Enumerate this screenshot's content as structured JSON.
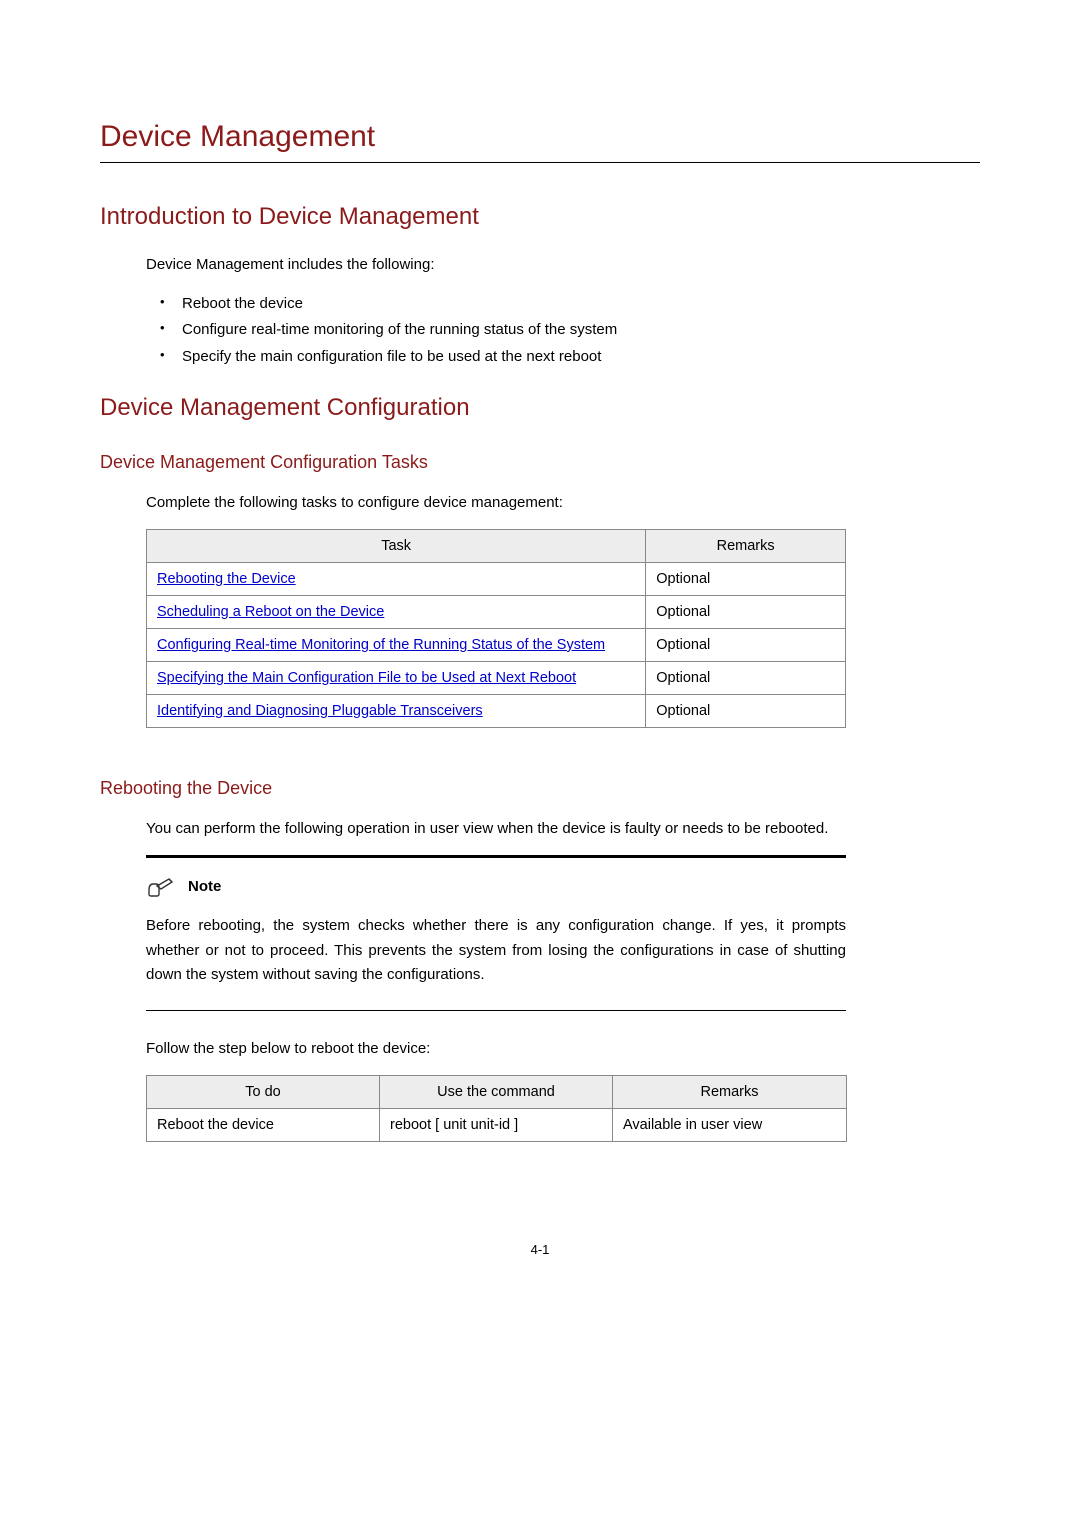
{
  "chapter_title": "Device Management",
  "intro": {
    "heading": "Introduction to Device Management",
    "lead": "Device Management includes the following:",
    "bullets": [
      "Reboot the device",
      "Configure real-time monitoring of the running status of the system",
      "Specify the main configuration file to be used at the next reboot"
    ]
  },
  "config": {
    "heading": "Device Management Configuration",
    "tasks_heading": "Device Management Configuration Tasks",
    "tasks_lead": "Complete the following tasks to configure device management:",
    "tasks_table": {
      "headers": {
        "task": "Task",
        "remarks": "Remarks"
      },
      "rows": [
        {
          "task": "Rebooting the Device",
          "remarks": "Optional"
        },
        {
          "task": "Scheduling a Reboot on the Device",
          "remarks": "Optional"
        },
        {
          "task": "Configuring Real-time Monitoring of the Running Status of the System",
          "remarks": "Optional"
        },
        {
          "task": "Specifying the Main Configuration File to be Used at Next Reboot",
          "remarks": "Optional"
        },
        {
          "task": "Identifying and Diagnosing Pluggable Transceivers",
          "remarks": "Optional"
        }
      ]
    }
  },
  "reboot": {
    "heading": "Rebooting the Device",
    "lead": "You can perform the following operation in user view when the device is faulty or needs to be rebooted.",
    "note_label": "Note",
    "note_text": "Before rebooting, the system checks whether there is any configuration change. If yes, it prompts whether or not to proceed. This prevents the system from losing the configurations in case of shutting down the system without saving the configurations.",
    "follow_text": "Follow the step below to reboot the device:",
    "cmd_table": {
      "headers": {
        "todo": "To do",
        "cmd": "Use the command",
        "remarks": "Remarks"
      },
      "row": {
        "todo": "Reboot the device",
        "cmd": "reboot  [ unit unit-id ]",
        "remarks": "Available in user view"
      }
    }
  },
  "page_number": "4-1"
}
